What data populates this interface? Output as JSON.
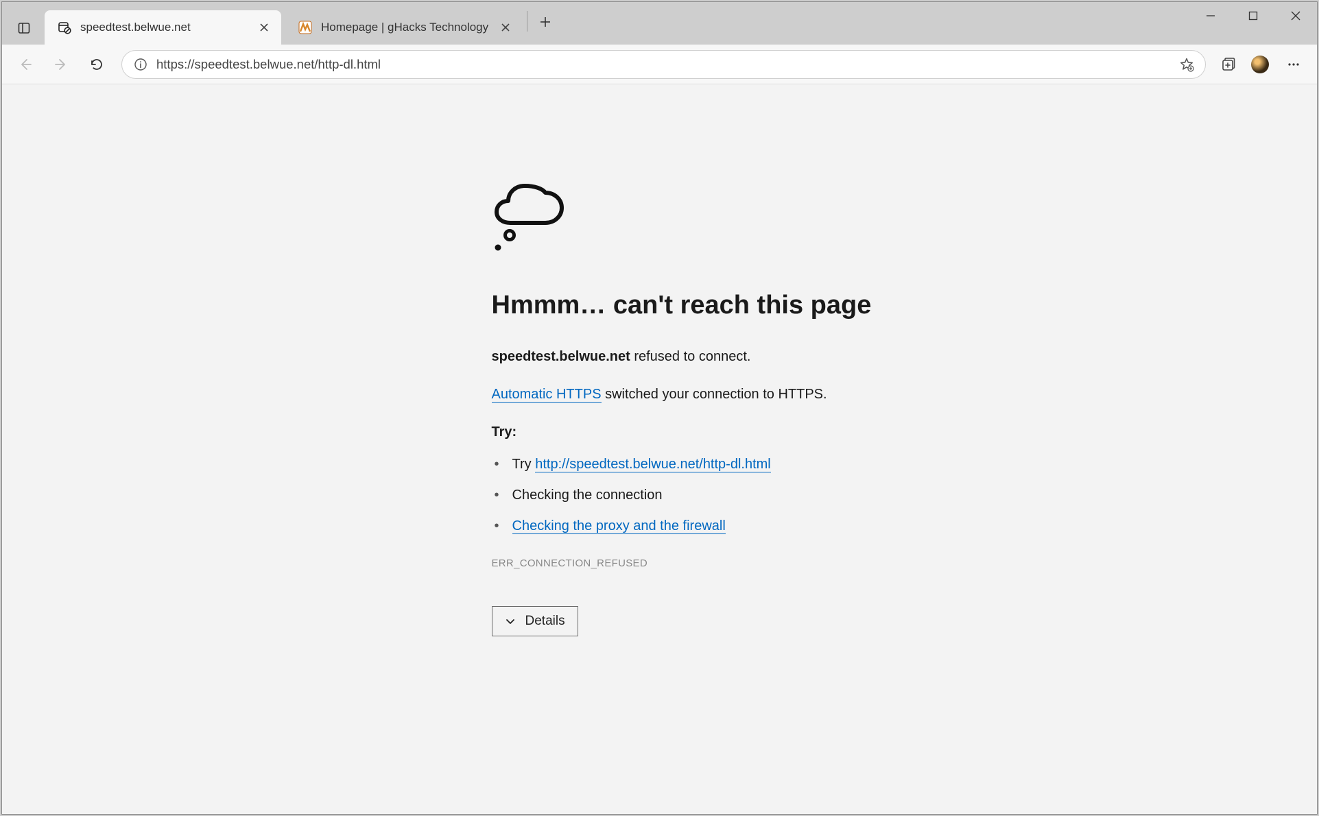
{
  "tabs": [
    {
      "title": "speedtest.belwue.net",
      "active": true
    },
    {
      "title": "Homepage | gHacks Technology",
      "active": false
    }
  ],
  "toolbar": {
    "url": "https://speedtest.belwue.net/http-dl.html"
  },
  "error": {
    "heading": "Hmmm… can't reach this page",
    "host": "speedtest.belwue.net",
    "refused_suffix": " refused to connect.",
    "auto_https_link": "Automatic HTTPS",
    "auto_https_suffix": " switched your connection to HTTPS.",
    "try_heading": "Try:",
    "try_prefix": "Try ",
    "http_link": "http://speedtest.belwue.net/http-dl.html",
    "try_check_conn": "Checking the connection",
    "try_proxy_link": "Checking the proxy and the firewall",
    "code": "ERR_CONNECTION_REFUSED",
    "details_label": "Details"
  }
}
